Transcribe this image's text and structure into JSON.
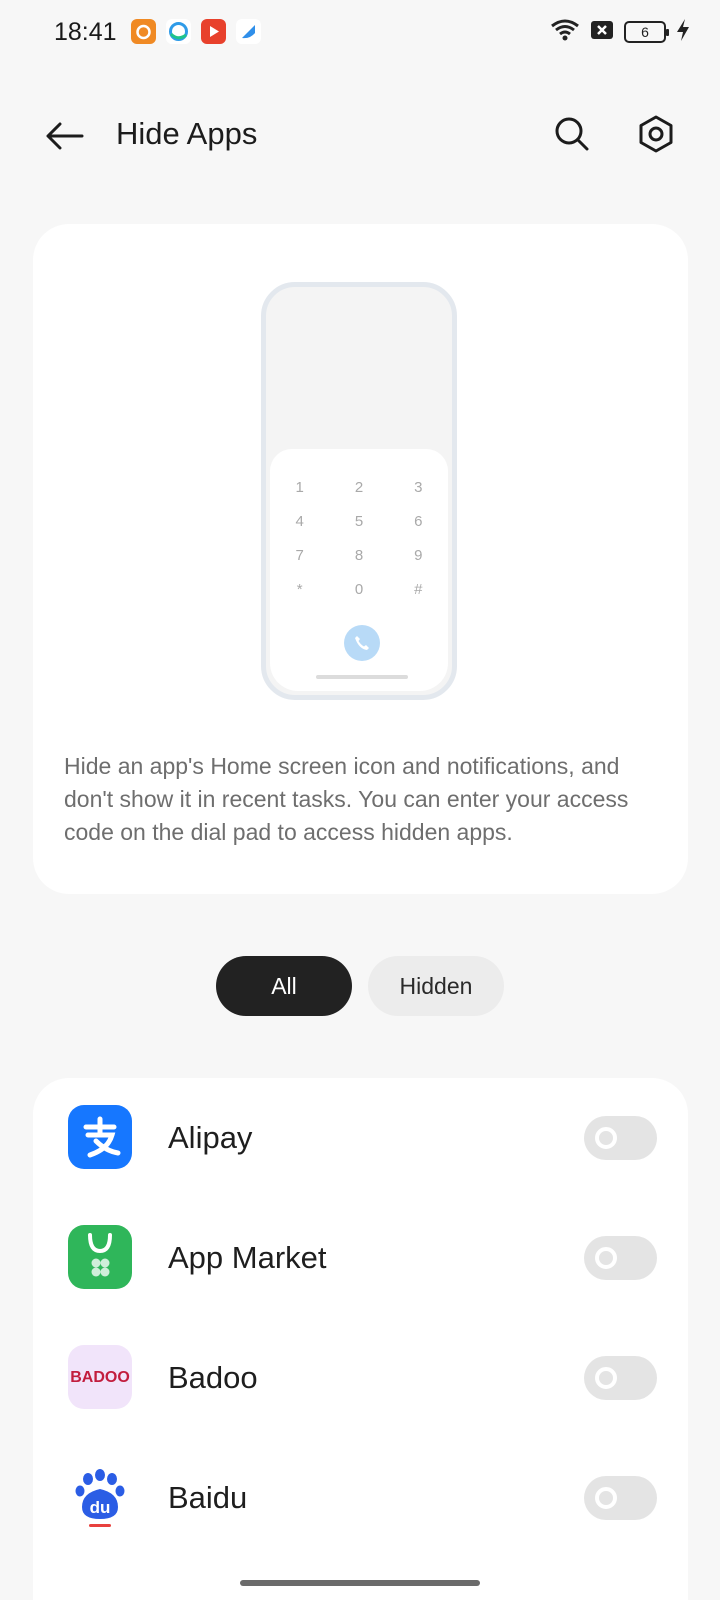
{
  "status_bar": {
    "time": "18:41",
    "notification_icons": [
      "app-notif-orange-icon",
      "browser-notif-icon",
      "video-notif-icon",
      "app-notif-blue-icon"
    ],
    "battery_level": "6"
  },
  "header": {
    "title": "Hide Apps"
  },
  "illustration": {
    "keys": [
      "1",
      "2",
      "3",
      "4",
      "5",
      "6",
      "7",
      "8",
      "9",
      "*",
      "0",
      "#"
    ]
  },
  "info": {
    "description": "Hide an app's Home screen icon and notifications, and don't show it in recent tasks. You can enter your access code on the dial pad to access hidden apps."
  },
  "tabs": [
    {
      "label": "All",
      "selected": true
    },
    {
      "label": "Hidden",
      "selected": false
    }
  ],
  "apps": [
    {
      "name": "Alipay",
      "icon": "alipay-icon",
      "hidden": false
    },
    {
      "name": "App Market",
      "icon": "app-market-icon",
      "hidden": false
    },
    {
      "name": "Badoo",
      "icon": "badoo-icon",
      "icon_text": "BADOO",
      "hidden": false
    },
    {
      "name": "Baidu",
      "icon": "baidu-icon",
      "icon_text": "du",
      "hidden": false
    }
  ],
  "colors": {
    "accent_dark": "#222222",
    "alipay_blue": "#1677ff",
    "market_green": "#2fb65a",
    "badoo_red": "#c21d3e",
    "baidu_blue": "#2b5de5"
  }
}
